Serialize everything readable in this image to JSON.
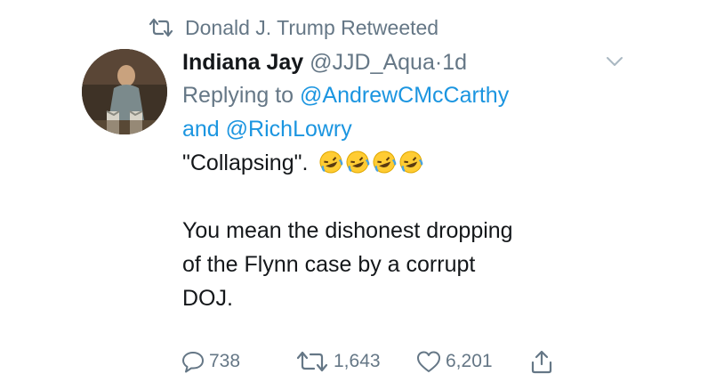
{
  "retweet": {
    "text": "Donald J. Trump Retweeted",
    "icon": "retweet-icon"
  },
  "author": {
    "display_name": "Indiana Jay",
    "handle": "@JJD_Aqua",
    "separator": "·",
    "time": "1d"
  },
  "reply": {
    "prefix": "Replying to",
    "mention1": "@AndrewCMcCarthy",
    "joiner": "and",
    "mention2": "@RichLowry"
  },
  "tweet": {
    "line1": "\"Collapsing\".",
    "emoji_count": 4,
    "emoji": "rolling-on-floor-laughing",
    "line2": "You mean the dishonest dropping",
    "line3": "of the Flynn case by a corrupt",
    "line4": "DOJ."
  },
  "actions": {
    "replies": "738",
    "retweets": "1,643",
    "likes": "6,201"
  },
  "colors": {
    "link": "#1b95e0",
    "muted": "#657786",
    "text": "#14171a"
  }
}
